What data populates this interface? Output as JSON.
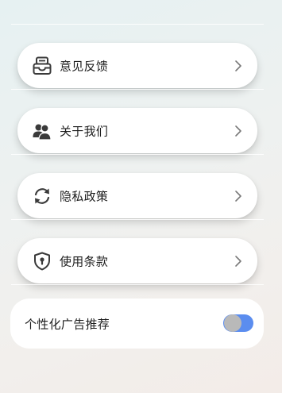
{
  "menu": {
    "items": [
      {
        "label": "意见反馈",
        "icon": "feedback-inbox-icon"
      },
      {
        "label": "关于我们",
        "icon": "users-icon"
      },
      {
        "label": "隐私政策",
        "icon": "refresh-icon"
      },
      {
        "label": "使用条款",
        "icon": "shield-lock-icon"
      }
    ],
    "chevron_icon": "chevron-right-icon"
  },
  "personalized_ads": {
    "label": "个性化广告推荐",
    "enabled": true,
    "track_color": "#5b8def",
    "knob_color": "#b9b9b9"
  }
}
